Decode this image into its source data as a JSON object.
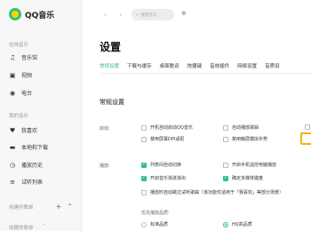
{
  "app": {
    "name": "QQ音乐"
  },
  "sidebar": {
    "online_section": "在线音乐",
    "online_items": [
      {
        "label": "音乐馆",
        "icon": "music-note-icon"
      },
      {
        "label": "视频",
        "icon": "video-icon"
      },
      {
        "label": "电台",
        "icon": "radio-icon"
      }
    ],
    "mine_section": "我的音乐",
    "mine_items": [
      {
        "label": "我喜欢",
        "icon": "heart-icon"
      },
      {
        "label": "本地和下载",
        "icon": "computer-icon"
      },
      {
        "label": "播放历史",
        "icon": "history-icon"
      },
      {
        "label": "试听列表",
        "icon": "playlist-icon"
      }
    ],
    "created_section": "创建的歌单",
    "collected_section": "收藏的歌单"
  },
  "topbar": {
    "search_placeholder": "搜索音乐"
  },
  "page": {
    "title": "设置",
    "tabs": [
      "常规设置",
      "下载与缓存",
      "桌面歌词",
      "快捷键",
      "音效插件",
      "网络设置",
      "音质设"
    ],
    "section_title": "常规设置",
    "startup_label": "启动:",
    "startup_options": [
      {
        "label": "开机自动启动QQ音乐",
        "checked": false
      },
      {
        "label": "自动播放歌曲",
        "checked": false
      },
      {
        "label": "禁用屏幕DPI适配",
        "checked": false
      },
      {
        "label": "禁用触屏模拟手势",
        "checked": false
      }
    ],
    "play_label": "播放:",
    "play_options": [
      {
        "label": "列表间自动切换",
        "checked": true
      },
      {
        "label": "开启手机遥控电脑播放",
        "checked": false
      },
      {
        "label": "开启音乐渐进渐出",
        "checked": true
      },
      {
        "label": "确定多媒体键盘",
        "checked": true
      },
      {
        "label": "播放时自动跳过试听歌曲（该功能仅适用于「我喜欢」等部分场景）",
        "checked": false
      }
    ],
    "quality_label": "优先播放品质:",
    "quality_options": [
      {
        "label": "标准品质",
        "checked": false
      },
      {
        "label": "HQ高品质",
        "checked": true
      }
    ]
  },
  "colors": {
    "accent": "#31c27c",
    "highlight": "#f6b20c"
  }
}
